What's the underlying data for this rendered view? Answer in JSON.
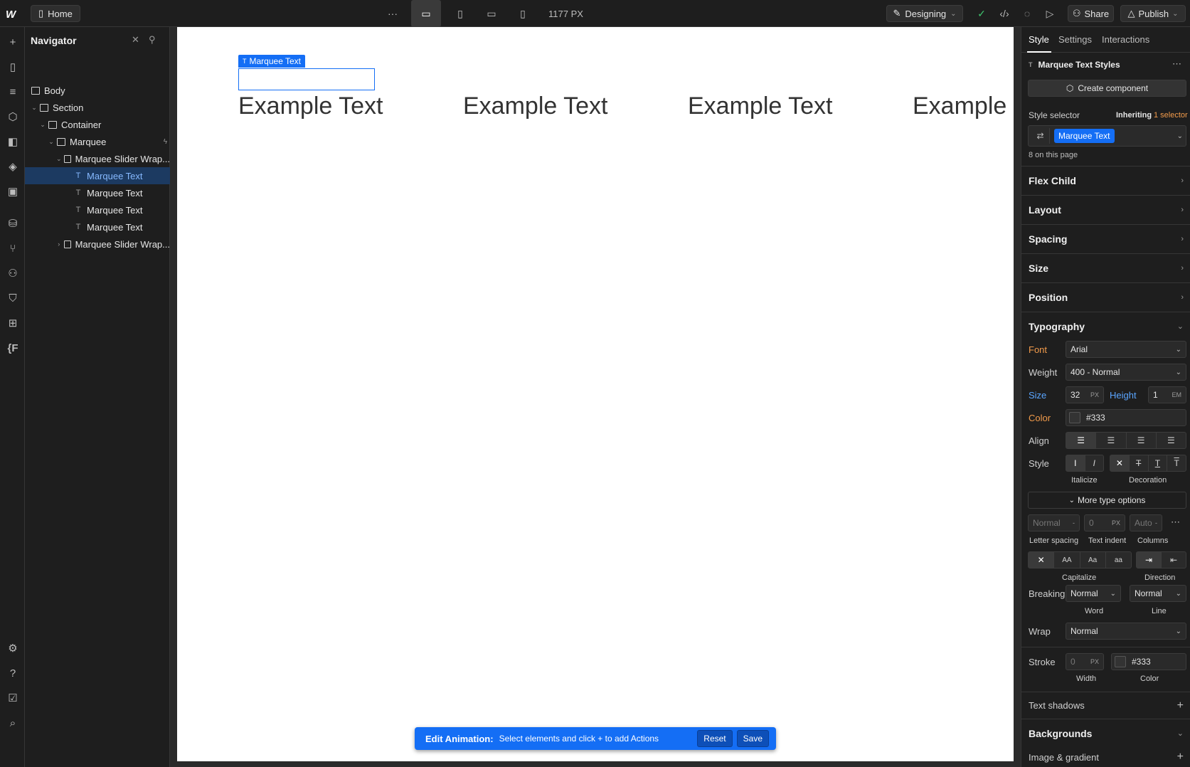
{
  "topbar": {
    "logo": "W",
    "home_label": "Home",
    "more_label": "···",
    "canvas_width": "1177 PX",
    "mode_label": "Designing",
    "share_label": "Share",
    "publish_label": "Publish"
  },
  "navigator": {
    "title": "Navigator",
    "items": [
      {
        "label": "Body"
      },
      {
        "label": "Section"
      },
      {
        "label": "Container"
      },
      {
        "label": "Marquee"
      },
      {
        "label": "Marquee Slider Wrap..."
      },
      {
        "label": "Marquee Text"
      },
      {
        "label": "Marquee Text"
      },
      {
        "label": "Marquee Text"
      },
      {
        "label": "Marquee Text"
      },
      {
        "label": "Marquee Slider Wrap..."
      }
    ]
  },
  "canvas": {
    "selection_label": "Marquee Text",
    "texts": [
      "Example Text",
      "Example Text",
      "Example Text",
      "Example"
    ]
  },
  "animation_bar": {
    "title": "Edit Animation:",
    "message": "Select elements and click + to add Actions",
    "reset_label": "Reset",
    "save_label": "Save"
  },
  "right_panel": {
    "tabs": [
      "Style",
      "Settings",
      "Interactions"
    ],
    "element_title": "Marquee Text Styles",
    "create_component_label": "Create component",
    "style_selector_label": "Style selector",
    "inheriting_label": "Inheriting",
    "inheriting_count": "1 selector",
    "selector_chip": "Marquee Text",
    "on_page": "8 on this page",
    "sections": [
      "Flex Child",
      "Layout",
      "Spacing",
      "Size",
      "Position",
      "Typography"
    ],
    "typography": {
      "font_label": "Font",
      "font_value": "Arial",
      "weight_label": "Weight",
      "weight_value": "400 - Normal",
      "size_label": "Size",
      "size_value": "32",
      "size_unit": "PX",
      "height_label": "Height",
      "height_value": "1",
      "height_unit": "EM",
      "color_label": "Color",
      "color_value": "#333",
      "align_label": "Align",
      "style_label": "Style",
      "italicize_label": "Italicize",
      "decoration_label": "Decoration",
      "more_type_label": "More type options",
      "letter_spacing_value": "Normal",
      "letter_spacing_label": "Letter spacing",
      "text_indent_value": "0",
      "text_indent_unit": "PX",
      "text_indent_label": "Text indent",
      "columns_value": "Auto",
      "columns_label": "Columns",
      "capitalize_label": "Capitalize",
      "direction_label": "Direction",
      "breaking_label": "Breaking",
      "word_value": "Normal",
      "word_label": "Word",
      "line_value": "Normal",
      "line_label": "Line",
      "wrap_label": "Wrap",
      "wrap_value": "Normal",
      "stroke_label": "Stroke",
      "stroke_width_value": "0",
      "stroke_width_unit": "PX",
      "stroke_width_label": "Width",
      "stroke_color_value": "#333",
      "stroke_color_label": "Color",
      "text_shadows_label": "Text shadows"
    },
    "backgrounds_title": "Backgrounds",
    "image_gradient_label": "Image & gradient"
  },
  "colors": {
    "accent": "#146ef5",
    "canvas_text": "#333333",
    "orange_label": "#f29b4b",
    "blue_label": "#5aa5ff"
  }
}
